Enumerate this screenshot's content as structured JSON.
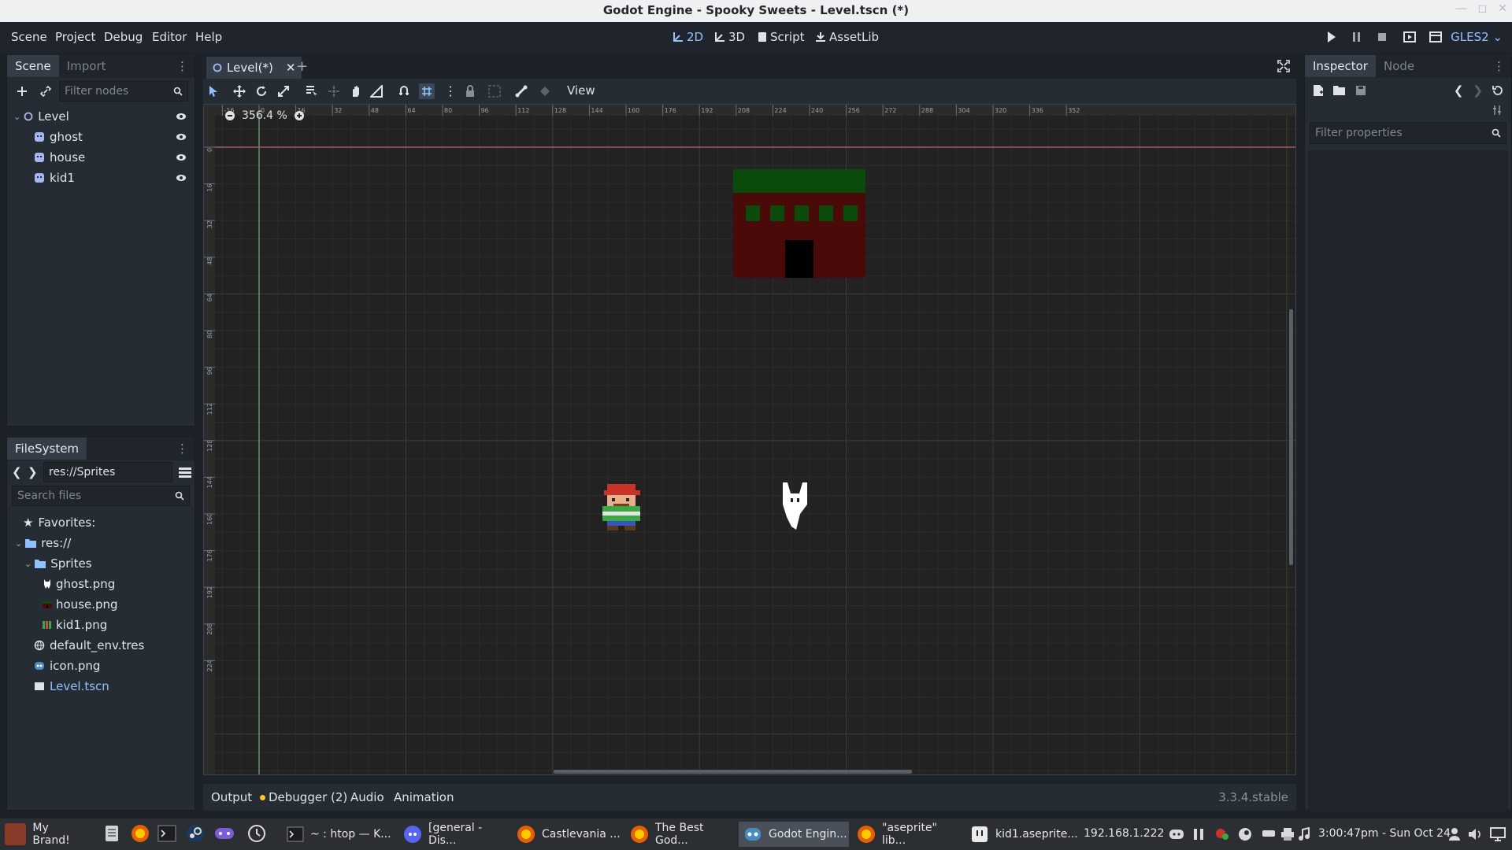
{
  "window": {
    "title": "Godot Engine - Spooky Sweets - Level.tscn (*)"
  },
  "menu": {
    "items": [
      "Scene",
      "Project",
      "Debug",
      "Editor",
      "Help"
    ],
    "workspaces": [
      "2D",
      "3D",
      "Script",
      "AssetLib"
    ],
    "active_workspace": "2D",
    "renderer": "GLES2"
  },
  "scene_dock": {
    "tabs": [
      "Scene",
      "Import"
    ],
    "filter_placeholder": "Filter nodes",
    "nodes": [
      {
        "name": "Level",
        "icon": "node2d-icon"
      },
      {
        "name": "ghost",
        "icon": "sprite-icon"
      },
      {
        "name": "house",
        "icon": "sprite-icon"
      },
      {
        "name": "kid1",
        "icon": "sprite-icon"
      }
    ]
  },
  "filesystem": {
    "tab": "FileSystem",
    "path": "res://Sprites",
    "search_placeholder": "Search files",
    "items": [
      {
        "label": "Favorites:",
        "icon": "star-icon",
        "depth": 0
      },
      {
        "label": "res://",
        "icon": "folder-icon",
        "depth": 0
      },
      {
        "label": "Sprites",
        "icon": "folder-icon",
        "depth": 1
      },
      {
        "label": "ghost.png",
        "icon": "ghost-thumb-icon",
        "depth": 2
      },
      {
        "label": "house.png",
        "icon": "house-thumb-icon",
        "depth": 2
      },
      {
        "label": "kid1.png",
        "icon": "kid-thumb-icon",
        "depth": 2
      },
      {
        "label": "default_env.tres",
        "icon": "environment-icon",
        "depth": 1
      },
      {
        "label": "icon.png",
        "icon": "godot-icon",
        "depth": 1
      },
      {
        "label": "Level.tscn",
        "icon": "scene-icon",
        "depth": 1
      }
    ]
  },
  "editor": {
    "scene_tab": "Level(*)",
    "view_menu": "View",
    "zoom": "356.4 %",
    "ruler_h": [
      "-16",
      "0",
      "16",
      "32",
      "48",
      "64",
      "80",
      "96",
      "112",
      "128",
      "144",
      "160",
      "176",
      "192",
      "208",
      "224",
      "240",
      "256",
      "272",
      "288",
      "304",
      "320",
      "336",
      "352"
    ],
    "ruler_v": [
      "0",
      "16",
      "32",
      "48",
      "64",
      "80",
      "96",
      "112",
      "128",
      "144",
      "160",
      "176",
      "192",
      "208",
      "224"
    ]
  },
  "bottom_panel": {
    "tabs": [
      "Output",
      "Debugger (2)",
      "Audio",
      "Animation"
    ],
    "version": "3.3.4.stable"
  },
  "inspector": {
    "tabs": [
      "Inspector",
      "Node"
    ],
    "filter_placeholder": "Filter properties"
  },
  "taskbar": {
    "start_label": "My Brand!",
    "tasks": [
      "~ : htop — K...",
      "[general - Dis...",
      "Castlevania ...",
      "The Best God...",
      "Godot Engin...",
      "\"aseprite\" lib...",
      "kid1.aseprite..."
    ],
    "ip": "192.168.1.222",
    "clock": "3:00:47pm - Sun Oct 24"
  },
  "colors": {
    "accent": "#8fc1ff",
    "panel": "#262c34",
    "viewport_bg": "#222222",
    "house_roof": "#0a4a0a",
    "house_wall": "#4a0a0a"
  }
}
